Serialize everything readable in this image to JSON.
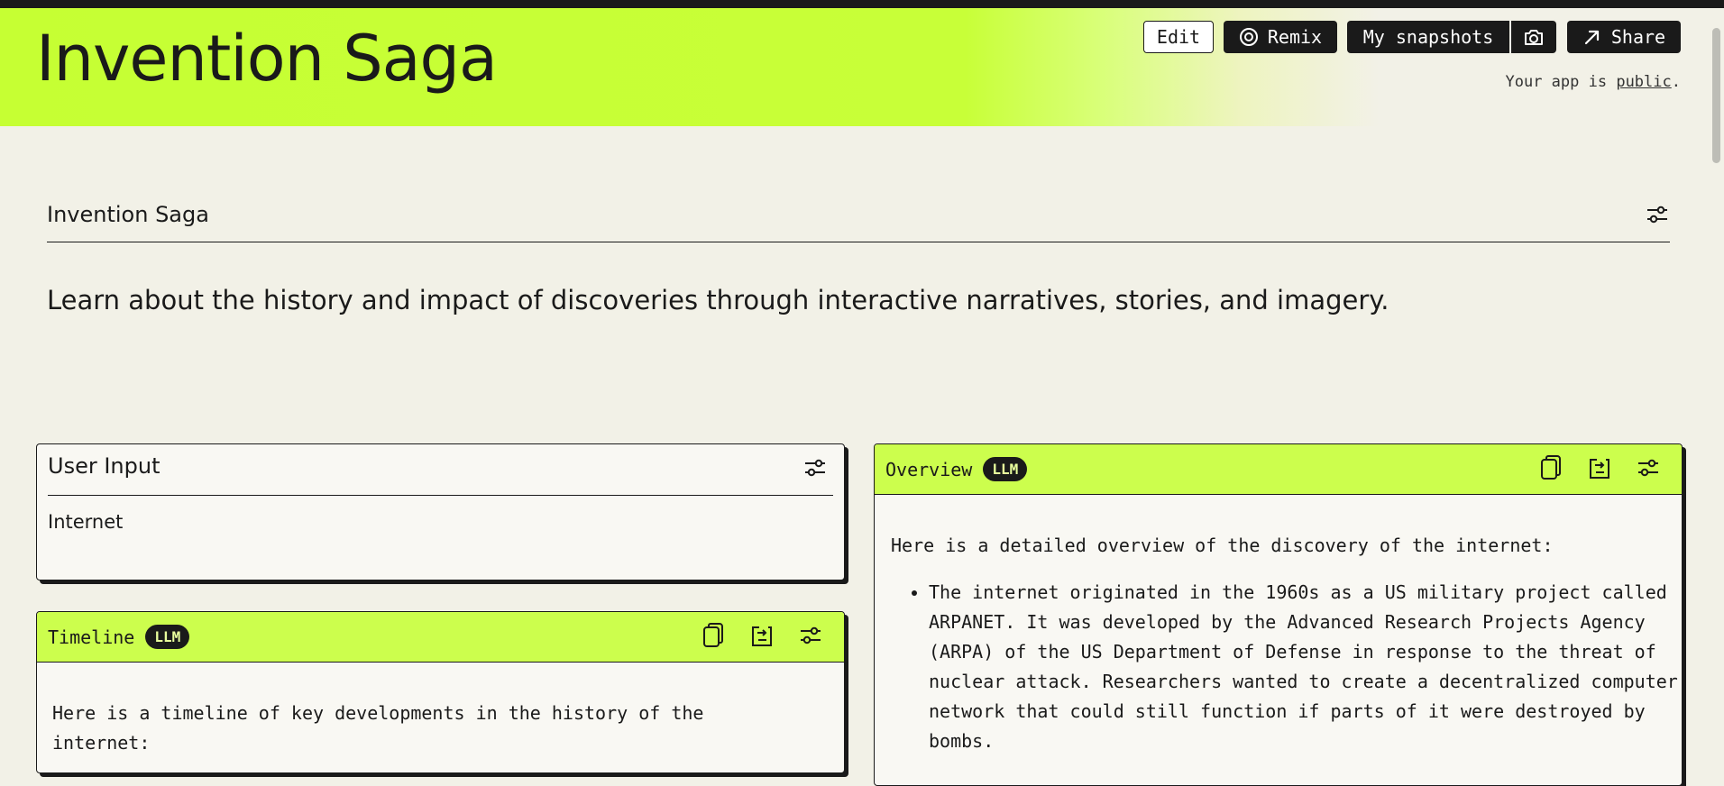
{
  "header": {
    "app_title": "Invention Saga",
    "edit_label": "Edit",
    "remix_label": "Remix",
    "snapshots_label": "My snapshots",
    "share_label": "Share",
    "public_prefix": "Your app is ",
    "public_link": "public",
    "public_suffix": "."
  },
  "section": {
    "title": "Invention Saga",
    "description": "Learn about the history and impact of discoveries through interactive narratives, stories, and imagery."
  },
  "user_input": {
    "title": "User Input",
    "value": "Internet"
  },
  "timeline": {
    "title": "Timeline",
    "badge": "LLM",
    "text": "Here is a timeline of key developments in the history of the internet:"
  },
  "overview": {
    "title": "Overview",
    "badge": "LLM",
    "intro": "Here is a detailed overview of the discovery of the internet:",
    "bullets": [
      "The internet originated in the 1960s as a US military project called ARPANET. It was developed by the Advanced Research Projects Agency (ARPA) of the US Department of Defense in response to the threat of nuclear attack. Researchers wanted to create a decentralized computer network that could still function if parts of it were destroyed by bombs."
    ]
  },
  "colors": {
    "accent": "#c6ff33",
    "card_header": "#ccfe4d",
    "background": "#f2f1e7",
    "dark": "#1a1a1a"
  },
  "icons": [
    "remix-icon",
    "camera-icon",
    "share-arrow-icon",
    "settings-sliders-icon",
    "copy-icon",
    "export-icon"
  ]
}
